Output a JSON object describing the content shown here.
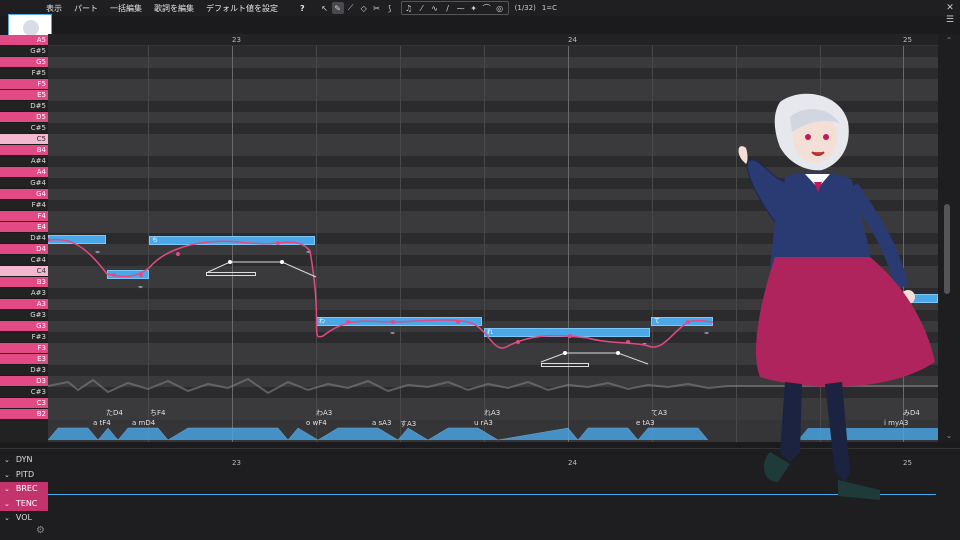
{
  "menu": [
    "表示",
    "パート",
    "一括編集",
    "歌詞を編集",
    "デフォルト値を設定"
  ],
  "help_label": "?",
  "measure_info": "(1/32)",
  "key_info": "1=C",
  "ruler": [
    "23",
    "24",
    "25"
  ],
  "keys": [
    "A5",
    "G#5",
    "G5",
    "F#5",
    "F5",
    "E5",
    "D#5",
    "D5",
    "C#5",
    "C5",
    "B4",
    "A#4",
    "A4",
    "G#4",
    "G4",
    "F#4",
    "F4",
    "E4",
    "D#4",
    "D4",
    "C#4",
    "C4",
    "B3",
    "A#3",
    "A3",
    "G#3",
    "G3",
    "F#3",
    "F3",
    "E3",
    "D#3",
    "D3",
    "C#3",
    "C3",
    "B2"
  ],
  "notes": [
    {
      "lyric": "",
      "label": "たD4"
    },
    {
      "lyric": "ち",
      "label": "ちF4"
    },
    {
      "lyric": "わ",
      "label": "わA3"
    },
    {
      "lyric": "れ",
      "label": "れA3"
    },
    {
      "lyric": "て",
      "label": "てA3"
    },
    {
      "lyric": "",
      "label": "みD4"
    }
  ],
  "phonemes": [
    "a tF4",
    "a mD4",
    "o wF4",
    "a sA3",
    "すA3",
    "u rA3",
    "e tA3",
    "i myA3"
  ],
  "params": [
    "DYN",
    "PITD",
    "BREC",
    "TENC",
    "VOL"
  ],
  "colors": {
    "accent": "#4aa7e8",
    "key_pink": "#e24a86",
    "param_pink": "#c3346d"
  }
}
